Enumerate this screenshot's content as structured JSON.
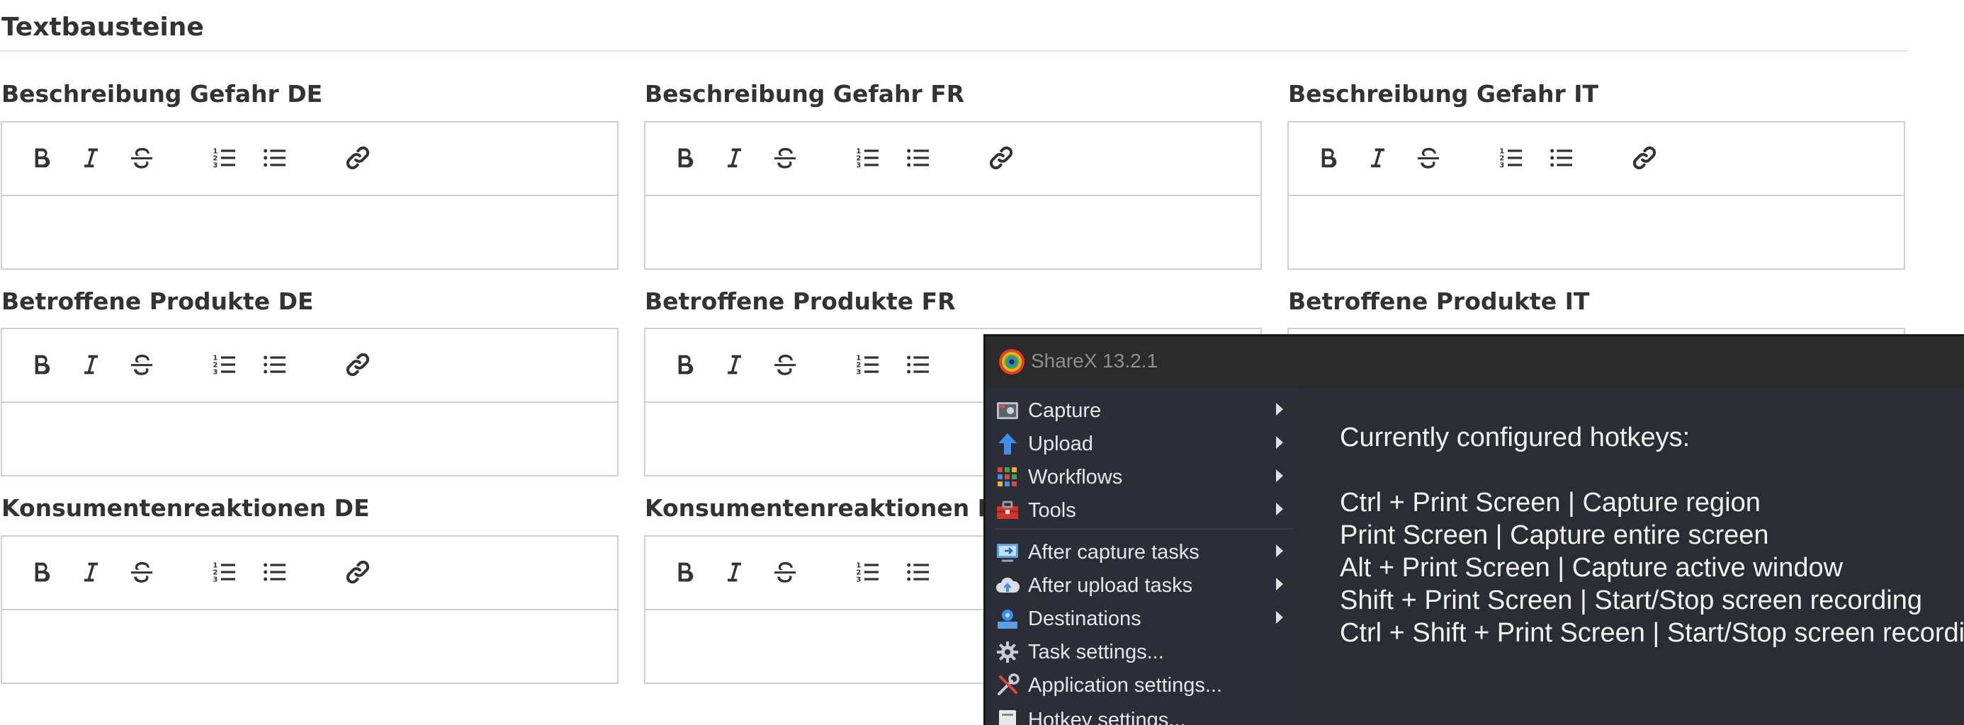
{
  "section": {
    "title": "Textbausteine"
  },
  "fields": [
    {
      "label": "Beschreibung Gefahr DE"
    },
    {
      "label": "Beschreibung Gefahr FR"
    },
    {
      "label": "Beschreibung Gefahr IT"
    },
    {
      "label": "Betroffene Produkte DE"
    },
    {
      "label": "Betroffene Produkte FR"
    },
    {
      "label": "Betroffene Produkte IT"
    },
    {
      "label": "Konsumentenreaktionen DE"
    },
    {
      "label": "Konsumentenreaktionen FR"
    }
  ],
  "toolbar": {
    "icons": [
      "bold-icon",
      "italic-icon",
      "strikethrough-icon",
      "ordered-list-icon",
      "bullet-list-icon",
      "link-icon"
    ]
  },
  "sharex": {
    "title": "ShareX 13.2.1",
    "menu": [
      {
        "label": "Capture",
        "icon": "camera-icon",
        "submenu": true
      },
      {
        "label": "Upload",
        "icon": "upload-arrow-icon",
        "submenu": true
      },
      {
        "label": "Workflows",
        "icon": "grid-dots-icon",
        "submenu": true
      },
      {
        "label": "Tools",
        "icon": "toolbox-icon",
        "submenu": true
      },
      {
        "label": "After capture tasks",
        "icon": "monitor-arrow-icon",
        "submenu": true
      },
      {
        "label": "After upload tasks",
        "icon": "cloud-upload-icon",
        "submenu": true
      },
      {
        "label": "Destinations",
        "icon": "destination-icon",
        "submenu": true
      },
      {
        "label": "Task settings...",
        "icon": "gear-icon",
        "submenu": false
      },
      {
        "label": "Application settings...",
        "icon": "wrench-screwdriver-icon",
        "submenu": false
      },
      {
        "label": "Hotkey settings...",
        "icon": "keyboard-icon",
        "submenu": false
      }
    ],
    "hotkeys": {
      "heading": "Currently configured hotkeys:",
      "lines": [
        "Ctrl + Print Screen  |  Capture region",
        "Print Screen  |  Capture entire screen",
        "Alt + Print Screen  |  Capture active window",
        "Shift + Print Screen  |  Start/Stop screen recording",
        "Ctrl + Shift + Print Screen  |  Start/Stop screen recording (GIF)"
      ]
    },
    "colors": {
      "window_bg": "#2a2d33",
      "titlebar_bg": "#2b2b2b",
      "menu_text": "#e6e6e6"
    }
  }
}
